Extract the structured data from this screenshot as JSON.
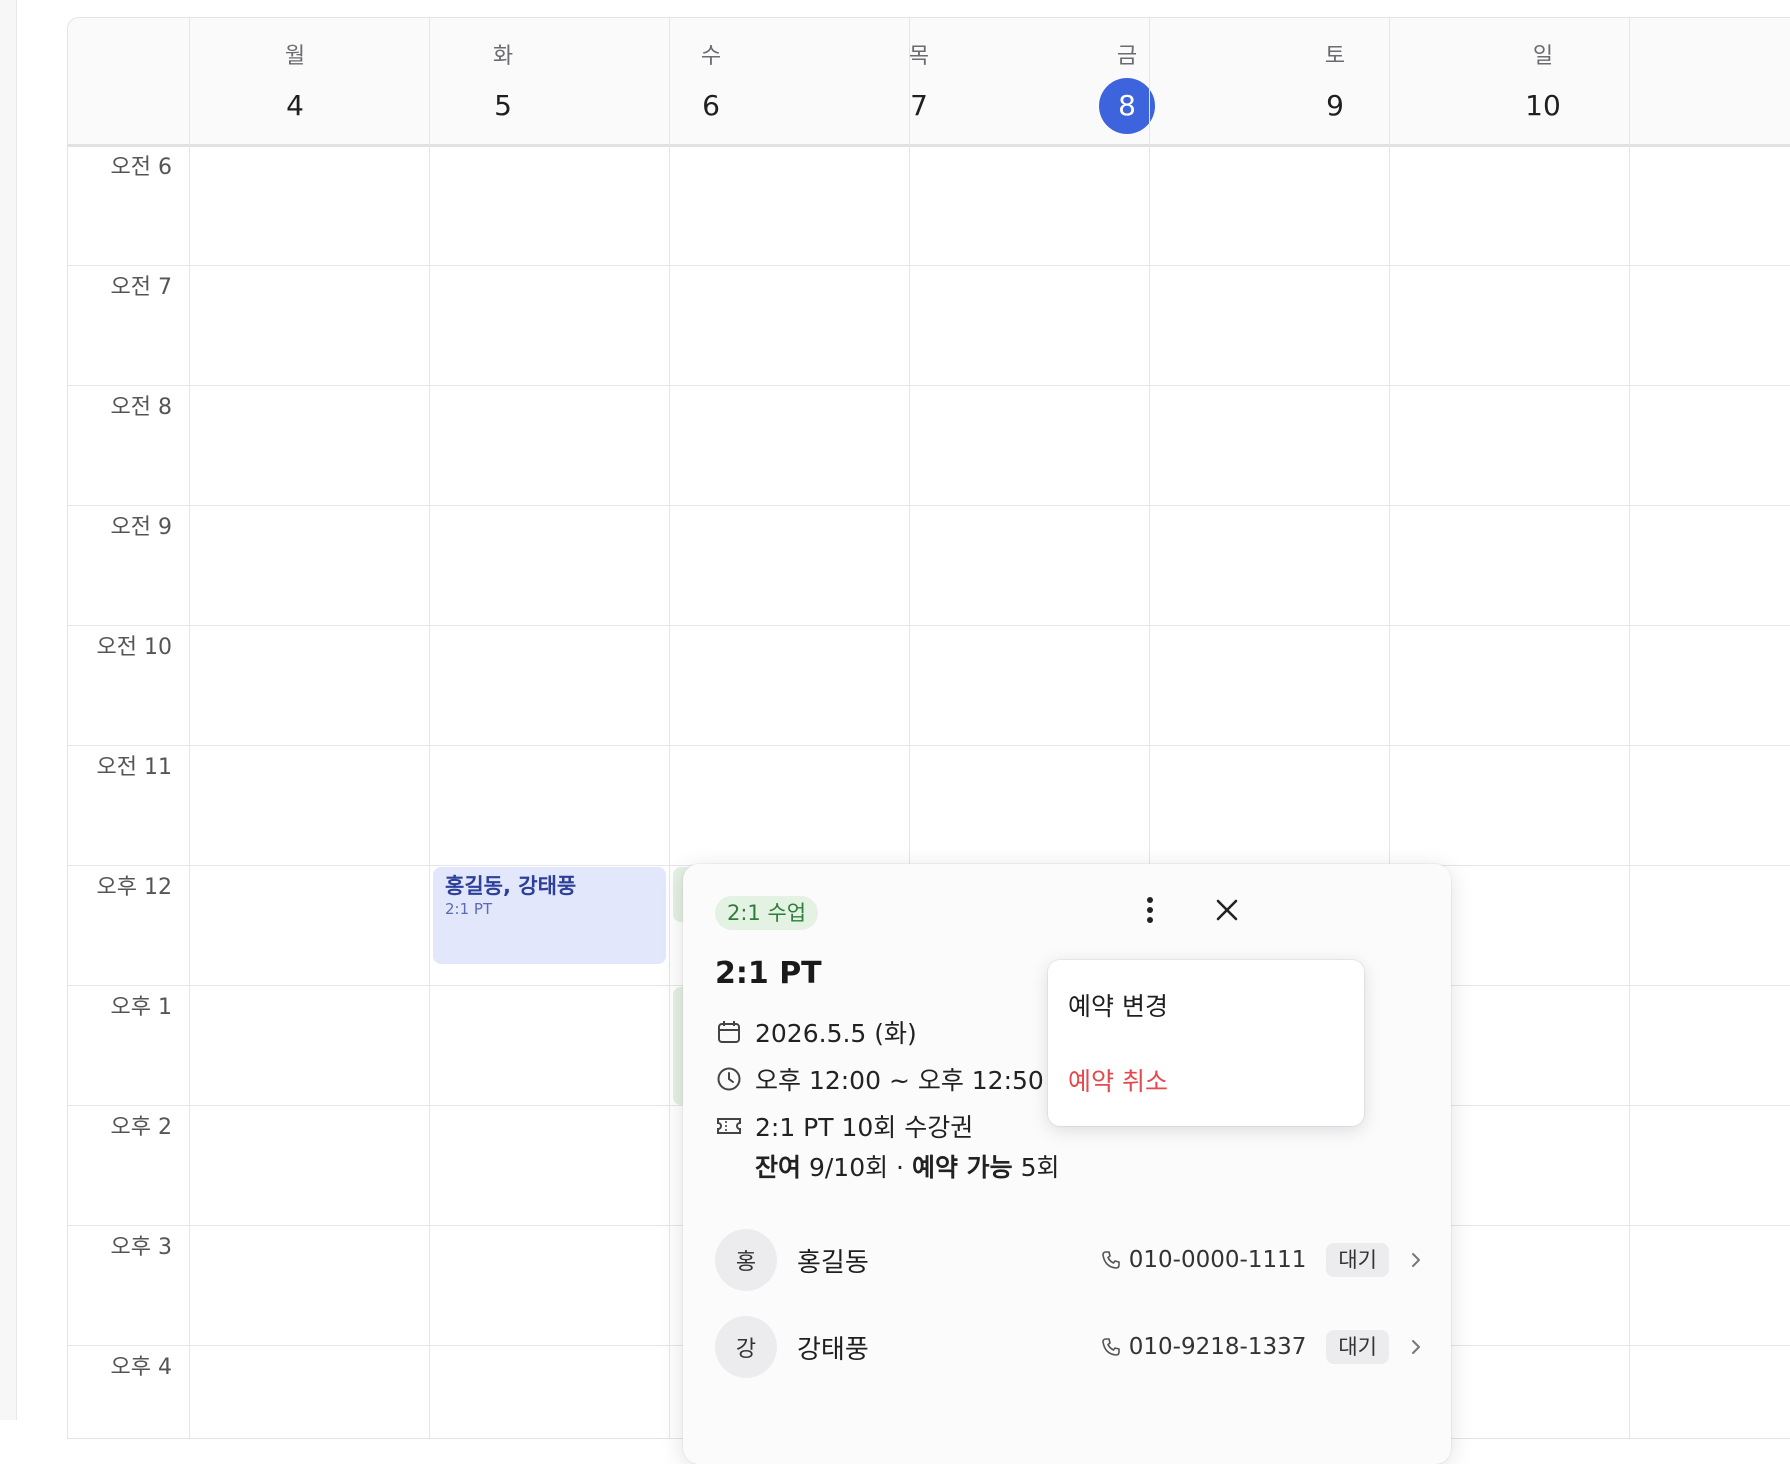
{
  "header": {
    "days": [
      {
        "dow": "월",
        "date": "4",
        "today": false
      },
      {
        "dow": "화",
        "date": "5",
        "today": false
      },
      {
        "dow": "수",
        "date": "6",
        "today": false
      },
      {
        "dow": "목",
        "date": "7",
        "today": false
      },
      {
        "dow": "금",
        "date": "8",
        "today": true
      },
      {
        "dow": "토",
        "date": "9",
        "today": false
      },
      {
        "dow": "일",
        "date": "10",
        "today": false
      }
    ]
  },
  "time_labels": [
    "오전 6",
    "오전 7",
    "오전 8",
    "오전 9",
    "오전 10",
    "오전 11",
    "오후 12",
    "오후 1",
    "오후 2",
    "오후 3",
    "오후 4"
  ],
  "events": [
    {
      "title": "홍길동, 강태풍",
      "subtitle": "2:1 PT",
      "color": "#e3e7fb"
    }
  ],
  "popover": {
    "badge": "2:1 수업",
    "title": "2:1 PT",
    "date": "2026.5.5 (화)",
    "time": "오후 12:00 ~ 오후 12:50 (",
    "pass": "2:1 PT 10회 수강권",
    "remaining_label": "잔여",
    "remaining_value": " 9/10회 · ",
    "bookable_label": "예약 가능",
    "bookable_value": " 5회",
    "members": [
      {
        "initial": "홍",
        "name": "홍길동",
        "phone": "010-0000-1111",
        "status": "대기"
      },
      {
        "initial": "강",
        "name": "강태풍",
        "phone": "010-9218-1337",
        "status": "대기"
      }
    ],
    "icons": {
      "more": "more-vertical-icon",
      "close": "close-icon"
    }
  },
  "menu": {
    "change": "예약 변경",
    "cancel": "예약 취소",
    "cancel_color": "#e5484d"
  },
  "colors": {
    "accent": "#3d63dd",
    "badge_green": "#2f7d3a"
  }
}
